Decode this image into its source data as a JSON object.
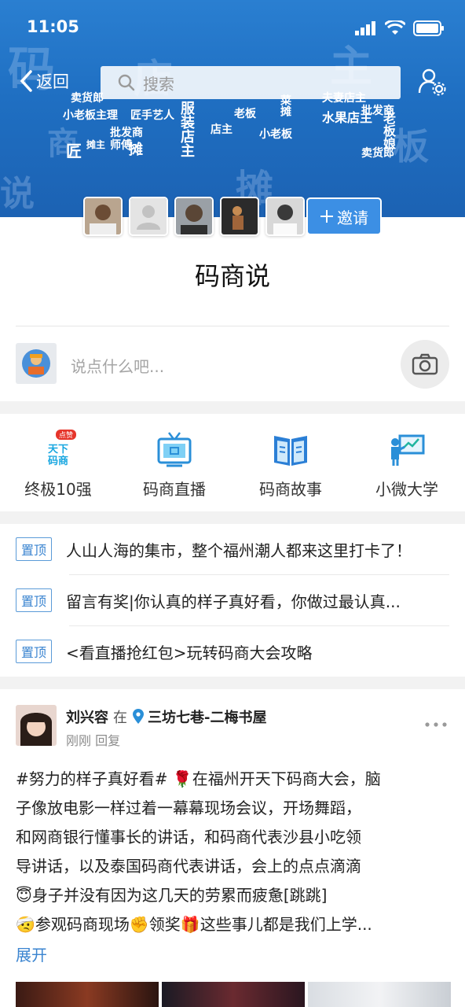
{
  "status": {
    "time": "11:05"
  },
  "header": {
    "back_label": "返回",
    "search_placeholder": "搜索"
  },
  "banner_cloud": [
    "卖货郎",
    "小老板主理",
    "匠手艺人",
    "匠",
    "批发商",
    "店主",
    "摊主",
    "师傅",
    "摊",
    "服装店主",
    "老板",
    "菜摊",
    "夫妻店主",
    "水果店主",
    "批发商",
    "老板娘",
    "卖货郎",
    "小老板"
  ],
  "group": {
    "invite_label": "邀请",
    "title": "码商说",
    "post_placeholder": "说点什么吧..."
  },
  "nav": [
    {
      "label": "终极10强",
      "icon": "trophy-badge-icon",
      "badge": "点赞",
      "icon_text": "天下码商"
    },
    {
      "label": "码商直播",
      "icon": "tv-live-icon"
    },
    {
      "label": "码商故事",
      "icon": "open-book-icon"
    },
    {
      "label": "小微大学",
      "icon": "teacher-board-icon"
    }
  ],
  "pinned": [
    {
      "tag": "置顶",
      "text": "人山人海的集市，整个福州潮人都来这里打卡了！"
    },
    {
      "tag": "置顶",
      "text": "留言有奖|你认真的样子真好看，你做过最认真..."
    },
    {
      "tag": "置顶",
      "text": "<看直播抢红包>玩转码商大会攻略"
    }
  ],
  "post": {
    "author": "刘兴容",
    "at_word": "在",
    "location": "三坊七巷-二梅书屋",
    "meta": "刚刚 回复",
    "body_lines": [
      "#努力的样子真好看# 🌹在福州开天下码商大会，脑",
      "子像放电影一样过着一幕幕现场会议，开场舞蹈，",
      "和网商银行懂事长的讲话，和码商代表沙县小吃领",
      "导讲话，以及泰国码商代表讲话，会上的点点滴滴",
      "😇身子并没有因为这几天的劳累而疲惫[跳跳]",
      "🤕参观码商现场✊领奖🎁这些事儿都是我们上学..."
    ],
    "expand_label": "展开"
  },
  "colors": {
    "brand_blue": "#1f6fc2",
    "accent_blue": "#3a84d0",
    "invite_bg": "#3c8fe4"
  }
}
